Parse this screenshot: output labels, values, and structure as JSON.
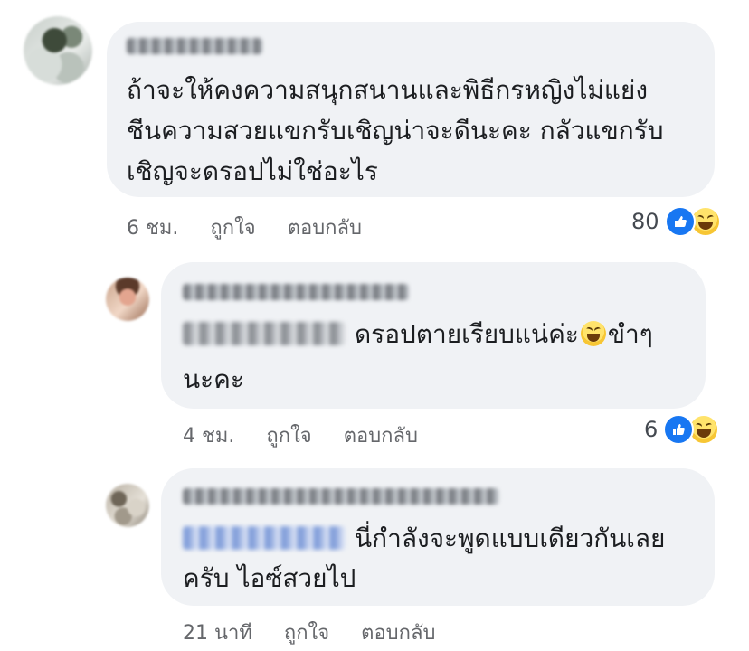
{
  "comments": [
    {
      "lines": [
        "ถ้าจะให้คงความสนุกสนานและพิธีกรหญิงไม่แย่ง",
        "ชีนความสวยแขกรับเชิญน่าจะดีนะคะ กลัวแขกรับ",
        "เชิญจะดรอปไม่ใช่อะไร"
      ],
      "time": "6 ชม.",
      "like_label": "ถูกใจ",
      "reply_label": "ตอบกลับ",
      "reaction_count": "80",
      "reaction_icons": [
        "like-icon",
        "haha-icon"
      ]
    },
    {
      "line1": "ดรอปตายเรียบแน่ค่ะ",
      "line1_after": "ขำๆ",
      "line2": "นะคะ",
      "inline_emoji": "haha-icon",
      "time": "4 ชม.",
      "like_label": "ถูกใจ",
      "reply_label": "ตอบกลับ",
      "reaction_count": "6",
      "reaction_icons": [
        "like-icon",
        "haha-icon"
      ]
    },
    {
      "line1": "นี่กำลังจะพูดแบบเดียวกันเลย",
      "line2": "ครับ ไอซ์สวยไป",
      "time": "21 นาที",
      "like_label": "ถูกใจ",
      "reply_label": "ตอบกลับ"
    }
  ],
  "colors": {
    "bubble": "#f0f2f5",
    "meta_text": "#65676b",
    "body_text": "#1c1e21",
    "like_blue": "#1877f2",
    "mention_blue": "#6d8fd6"
  }
}
